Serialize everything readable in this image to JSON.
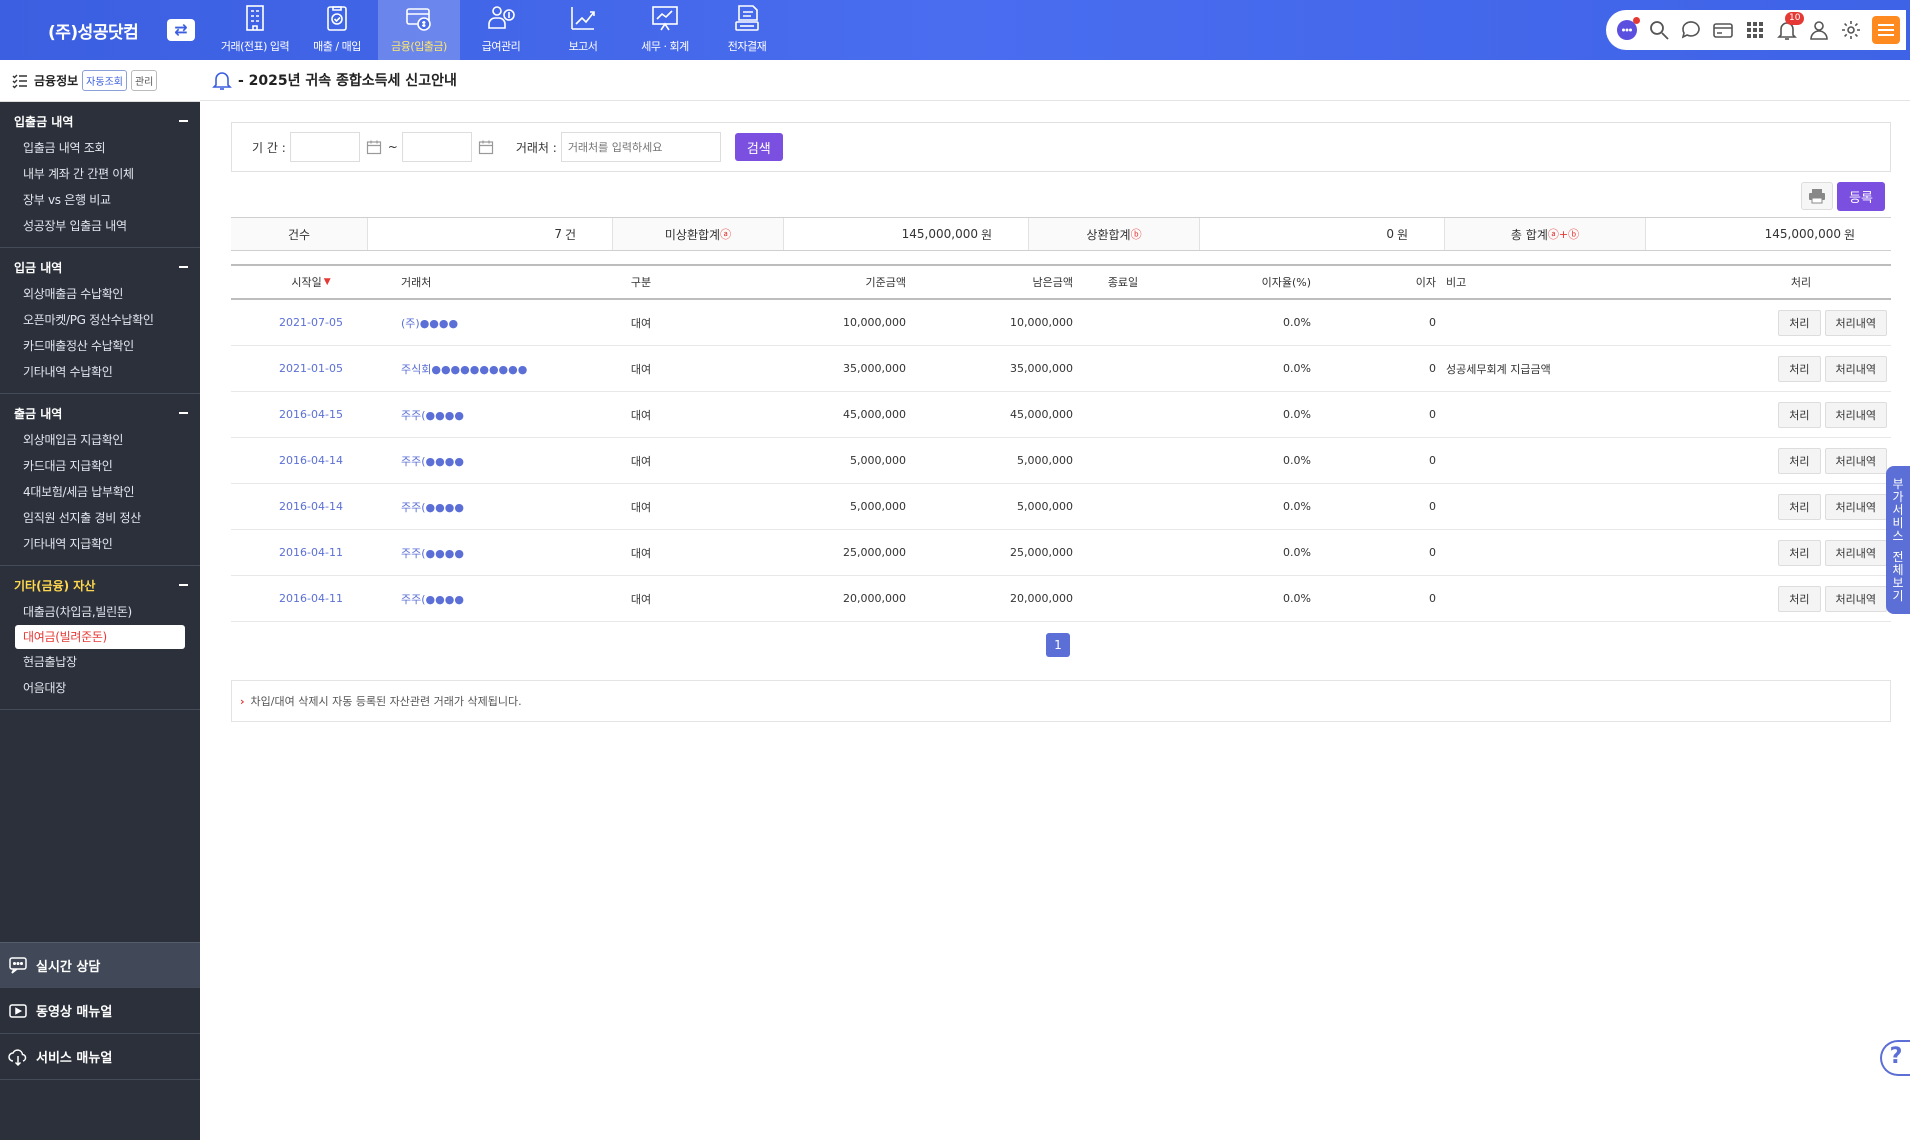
{
  "brand": {
    "name": "(주)성공닷컴",
    "switch_icon": "⇄"
  },
  "menu": [
    {
      "label": "거래(전표) 입력",
      "icon": "building-icon",
      "active": false
    },
    {
      "label": "매출 / 매입",
      "icon": "clipboard-check-icon",
      "active": false
    },
    {
      "label": "금융(입출금)",
      "icon": "card-money-icon",
      "active": true
    },
    {
      "label": "급여관리",
      "icon": "payroll-icon",
      "active": false
    },
    {
      "label": "보고서",
      "icon": "report-chart-icon",
      "active": false
    },
    {
      "label": "세무 · 회계",
      "icon": "tax-board-icon",
      "active": false
    },
    {
      "label": "전자결재",
      "icon": "approval-stack-icon",
      "active": false
    }
  ],
  "utility": {
    "notification_count": "10"
  },
  "sidebar": {
    "header_title": "금융정보",
    "chip_auto": "자동조회",
    "chip_manage": "관리",
    "groups": [
      {
        "title": "입출금 내역",
        "items": [
          "입출금 내역 조회",
          "내부 계좌 간 간편 이체",
          "장부 vs 은행 비교",
          "성공장부 입출금 내역"
        ]
      },
      {
        "title": "입금 내역",
        "items": [
          "외상매출금 수납확인",
          "오픈마켓/PG 정산수납확인",
          "카드매출정산 수납확인",
          "기타내역 수납확인"
        ]
      },
      {
        "title": "출금 내역",
        "items": [
          "외상매입금 지급확인",
          "카드대금 지급확인",
          "4대보험/세금 납부확인",
          "임직원 선지출 경비 정산",
          "기타내역 지급확인"
        ]
      },
      {
        "title": "기타(금융) 자산",
        "items": [
          "대출금(차입금,빌린돈)",
          "대여금(빌려준돈)",
          "현금출납장",
          "어음대장"
        ]
      }
    ],
    "bottom": [
      "실시간 상담",
      "동영상 매뉴얼",
      "서비스 매뉴얼"
    ]
  },
  "notice": {
    "text": "- 2025년 귀속 종합소득세 신고안내"
  },
  "filter": {
    "period_label": "기 간 :",
    "tilde": "~",
    "vendor_label": "거래처 :",
    "vendor_placeholder": "거래처를 입력하세요",
    "search_label": "검색"
  },
  "actions": {
    "register_label": "등록"
  },
  "summary": {
    "count_label": "건수",
    "count_value": "7",
    "count_unit": "건",
    "unpaid_label": "미상환합계",
    "unpaid_mark": "ⓐ",
    "unpaid_value": "145,000,000",
    "unpaid_unit": "원",
    "paid_label": "상환합계",
    "paid_mark": "ⓑ",
    "paid_value": "0",
    "paid_unit": "원",
    "total_label": "총 합계",
    "total_mark": "ⓐ+ⓑ",
    "total_value": "145,000,000",
    "total_unit": "원"
  },
  "table": {
    "headers": {
      "date": "시작일",
      "vendor": "거래처",
      "type": "구분",
      "base": "기준금액",
      "remain": "남은금액",
      "end": "종료일",
      "rate": "이자율(%)",
      "interest": "이자",
      "memo": "비고",
      "action": "처리"
    },
    "btn_process": "처리",
    "btn_history": "처리내역",
    "rows": [
      {
        "date": "2021-07-05",
        "vendor": "(주)●●●●",
        "type": "대여",
        "base": "10,000,000",
        "remain": "10,000,000",
        "end": "",
        "rate": "0.0%",
        "interest": "0",
        "memo": ""
      },
      {
        "date": "2021-01-05",
        "vendor": "주식회●●●●●●●●●●",
        "type": "대여",
        "base": "35,000,000",
        "remain": "35,000,000",
        "end": "",
        "rate": "0.0%",
        "interest": "0",
        "memo": "성공세무회계 지급금액"
      },
      {
        "date": "2016-04-15",
        "vendor": "주주(●●●●",
        "type": "대여",
        "base": "45,000,000",
        "remain": "45,000,000",
        "end": "",
        "rate": "0.0%",
        "interest": "0",
        "memo": ""
      },
      {
        "date": "2016-04-14",
        "vendor": "주주(●●●●",
        "type": "대여",
        "base": "5,000,000",
        "remain": "5,000,000",
        "end": "",
        "rate": "0.0%",
        "interest": "0",
        "memo": ""
      },
      {
        "date": "2016-04-14",
        "vendor": "주주(●●●●",
        "type": "대여",
        "base": "5,000,000",
        "remain": "5,000,000",
        "end": "",
        "rate": "0.0%",
        "interest": "0",
        "memo": ""
      },
      {
        "date": "2016-04-11",
        "vendor": "주주(●●●●",
        "type": "대여",
        "base": "25,000,000",
        "remain": "25,000,000",
        "end": "",
        "rate": "0.0%",
        "interest": "0",
        "memo": ""
      },
      {
        "date": "2016-04-11",
        "vendor": "주주(●●●●",
        "type": "대여",
        "base": "20,000,000",
        "remain": "20,000,000",
        "end": "",
        "rate": "0.0%",
        "interest": "0",
        "memo": ""
      }
    ]
  },
  "pagination": {
    "current": "1"
  },
  "footer_note": "차입/대여 삭제시 자동 등록된 자산관련 거래가 삭제됩니다.",
  "side_tab": {
    "line1": "부가서비스",
    "line2": "전체보기"
  },
  "help": {
    "symbol": "?"
  },
  "colors": {
    "brand_blue": "#3b5fe0",
    "accent_purple": "#7b4fe0",
    "link_blue": "#5b6fd6",
    "sidebar_dark": "#2b303b",
    "alert_red": "#e53935"
  }
}
